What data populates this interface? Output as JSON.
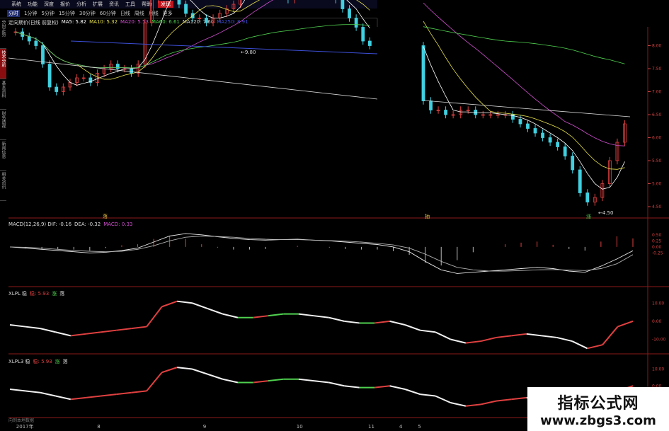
{
  "menu": {
    "items": [
      "系统",
      "功能",
      "深度",
      "报价",
      "分析",
      "扩展",
      "资讯",
      "工具",
      "帮助"
    ],
    "active": "发现"
  },
  "periods": {
    "items": [
      "分时",
      "1分钟",
      "5分钟",
      "15分钟",
      "30分钟",
      "60分钟",
      "日线",
      "周线",
      "月线",
      "更多"
    ],
    "active": "分时"
  },
  "sidetabs": [
    "分时走势",
    "技术分析",
    "基本资料",
    "财务透视",
    "新闻信息",
    "相关资讯"
  ],
  "ma_legend": {
    "name": "定向期价(日线 前复权)",
    "items": [
      {
        "label": "MA5: 5.82",
        "color": "#ffffff"
      },
      {
        "label": "MA10: 5.32",
        "color": "#e8e24c"
      },
      {
        "label": "MA20: 5.53",
        "color": "#d14fd0"
      },
      {
        "label": "MA60: 6.61",
        "color": "#4fd14f"
      },
      {
        "label": "MA120: 7.60",
        "color": "#d9d9d9"
      },
      {
        "label": "MA250: 8.91",
        "color": "#3c4fd6"
      }
    ]
  },
  "macd_legend": {
    "items": [
      {
        "label": "MACD(12,26,9) DIF: -0.16",
        "color": "#dddddd"
      },
      {
        "label": "DEA: -0.32",
        "color": "#dddddd"
      },
      {
        "label": "MACD: 0.33",
        "color": "#d14fd0"
      }
    ]
  },
  "xlpl_legend": {
    "items": [
      {
        "label": "XLPL 稳",
        "color": "#dddddd"
      },
      {
        "label": "稳: 5.93",
        "color": "#e04040"
      },
      {
        "label": "涨",
        "color": "#4fd14f"
      },
      {
        "label": "落",
        "color": "#dddddd"
      }
    ]
  },
  "xlpl3_legend": {
    "items": [
      {
        "label": "XLPL3 稳",
        "color": "#dddddd"
      },
      {
        "label": "稳: 5.93",
        "color": "#e04040"
      },
      {
        "label": "涨",
        "color": "#4fd14f"
      },
      {
        "label": "落",
        "color": "#dddddd"
      }
    ]
  },
  "annotations": {
    "high": "9.80",
    "low": "4.50",
    "signal_left": "落",
    "signal_mid": "抽",
    "signal_right": "涨"
  },
  "xaxis": [
    {
      "label": "2017年",
      "pos": 0.01
    },
    {
      "label": "8",
      "pos": 0.14
    },
    {
      "label": "9",
      "pos": 0.31
    },
    {
      "label": "10",
      "pos": 0.46
    },
    {
      "label": "11",
      "pos": 0.575
    },
    {
      "label": "4",
      "pos": 0.625
    },
    {
      "label": "5",
      "pos": 0.655
    }
  ],
  "footer": "向到本地数据",
  "logo": {
    "line1": "指标公式网",
    "line2": "www.zbgs3.com"
  },
  "chart_data": [
    {
      "type": "candlestick",
      "name": "price",
      "yticks": [
        8.0,
        7.5,
        7.0,
        6.5,
        6.0,
        5.5,
        5.0,
        4.5
      ],
      "ylim": [
        4.3,
        8.3
      ],
      "close": [
        8.3,
        8.2,
        8.1,
        8.0,
        7.6,
        7.1,
        7.0,
        7.1,
        7.2,
        7.3,
        7.3,
        7.2,
        7.4,
        7.5,
        7.6,
        7.5,
        7.5,
        7.4,
        7.6,
        8.5,
        9.0,
        9.3,
        9.4,
        9.1,
        8.9,
        8.7,
        8.6,
        8.6,
        8.5,
        8.6,
        8.7,
        8.8,
        8.9,
        9.2,
        9.8,
        9.6,
        9.4,
        9.3,
        9.4,
        9.2,
        9.0,
        9.1,
        9.3,
        9.2,
        9.3,
        9.1,
        9.2,
        9.0,
        8.8,
        8.6,
        8.4,
        8.1,
        8.0,
        6.8,
        6.6,
        6.6,
        6.5,
        6.5,
        6.6,
        6.6,
        6.5,
        6.5,
        6.5,
        6.5,
        6.5,
        6.4,
        6.3,
        6.2,
        6.1,
        6.0,
        5.9,
        5.8,
        5.6,
        5.3,
        4.8,
        4.6,
        4.7,
        5.0,
        5.5,
        5.9,
        6.3
      ]
    },
    {
      "type": "line",
      "name": "macd",
      "yticks": [
        0.5,
        0.25,
        0.0,
        -0.25
      ],
      "ylim": [
        -1.5,
        0.7
      ],
      "dif": [
        0.0,
        -0.05,
        -0.1,
        -0.15,
        -0.2,
        -0.25,
        -0.22,
        -0.15,
        -0.05,
        0.2,
        0.45,
        0.55,
        0.5,
        0.42,
        0.35,
        0.3,
        0.28,
        0.3,
        0.32,
        0.28,
        0.25,
        0.2,
        0.15,
        0.1,
        0.0,
        -0.2,
        -0.6,
        -0.95,
        -1.1,
        -1.05,
        -1.0,
        -0.95,
        -0.9,
        -0.85,
        -0.9,
        -1.0,
        -1.05,
        -0.8,
        -0.5,
        -0.16
      ],
      "dea": [
        0.0,
        -0.02,
        -0.05,
        -0.1,
        -0.15,
        -0.18,
        -0.2,
        -0.18,
        -0.1,
        0.05,
        0.25,
        0.4,
        0.45,
        0.43,
        0.4,
        0.35,
        0.32,
        0.3,
        0.3,
        0.28,
        0.26,
        0.24,
        0.2,
        0.15,
        0.08,
        -0.05,
        -0.3,
        -0.6,
        -0.85,
        -0.95,
        -1.0,
        -1.0,
        -0.98,
        -0.95,
        -0.94,
        -0.96,
        -0.98,
        -0.9,
        -0.7,
        -0.32
      ]
    },
    {
      "type": "line",
      "name": "xlpl",
      "yticks": [
        10.0,
        0.0,
        -10.0
      ],
      "ylim": [
        -18,
        14
      ],
      "values": [
        -2,
        -3,
        -4,
        -6,
        -8,
        -7,
        -6,
        -5,
        -4,
        -3,
        8,
        11,
        10,
        7,
        4,
        2,
        2,
        3,
        4,
        4,
        3,
        2,
        0,
        -1,
        -1,
        0,
        -2,
        -5,
        -6,
        -10,
        -12,
        -11,
        -9,
        -8,
        -7,
        -8,
        -9,
        -11,
        -15,
        -13,
        -3,
        0
      ]
    }
  ]
}
